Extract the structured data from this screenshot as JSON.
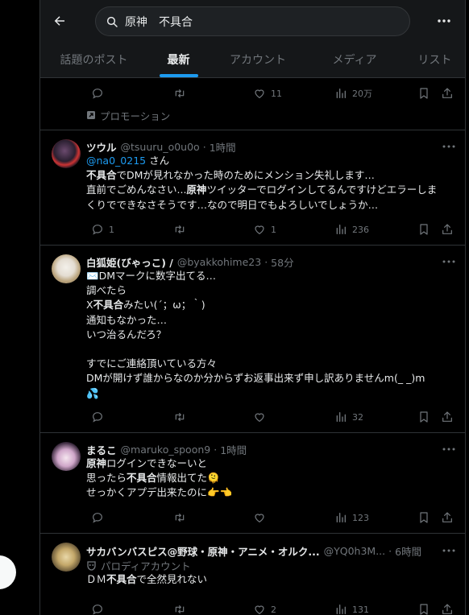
{
  "header": {
    "search_query": "原神　不具合",
    "tabs": [
      {
        "label": "話題のポスト",
        "active": false
      },
      {
        "label": "最新",
        "active": true
      },
      {
        "label": "アカウント",
        "active": false
      },
      {
        "label": "メディア",
        "active": false
      },
      {
        "label": "リスト",
        "active": false
      }
    ]
  },
  "colors": {
    "accent": "#1d9bf0",
    "background": "#000000",
    "muted": "#71767b"
  },
  "promo": {
    "reply_count": "",
    "retweet_count": "",
    "like_count": "11",
    "views": "20万",
    "label": "プロモーション"
  },
  "posts": [
    {
      "name": "ツウル",
      "handle": "@tsuuru_o0u0o",
      "time": "1時間",
      "mention": "@na0_0215",
      "mention_suffix": " さん",
      "lines": [
        [
          [
            "b",
            "不具合"
          ],
          [
            "t",
            "でDMが見れなかった時のためにメンション失礼します…"
          ]
        ],
        [
          [
            "t",
            "直前でごめんなさい..."
          ],
          [
            "b",
            "原神"
          ],
          [
            "t",
            "ツイッターでログインしてるんですけどエラーしま"
          ]
        ],
        [
          [
            "t",
            "くりでできなさそうです…なので明日でもよろしいでしょうか…"
          ]
        ]
      ],
      "reply_count": "1",
      "retweet_count": "",
      "like_count": "1",
      "views": "236"
    },
    {
      "name": "白狐姫(びゃっこ) /",
      "handle": "@byakkohime23",
      "time": "58分",
      "lines": [
        [
          [
            "t",
            "✉️DMマークに数字出てる…"
          ]
        ],
        [
          [
            "t",
            "調べたら"
          ]
        ],
        [
          [
            "t",
            "X"
          ],
          [
            "b",
            "不具合"
          ],
          [
            "t",
            "みたい(´；ω；｀)"
          ]
        ],
        [
          [
            "t",
            "通知もなかった…"
          ]
        ],
        [
          [
            "t",
            "いつ治るんだろ？"
          ]
        ],
        [
          [
            "t",
            " "
          ]
        ],
        [
          [
            "t",
            "すでにご連絡頂いている方々"
          ]
        ],
        [
          [
            "t",
            "DMが開けず誰からなのか分からずお返事出来ず申し訳ありませんm(_ _)m"
          ]
        ],
        [
          [
            "t",
            "💦"
          ]
        ]
      ],
      "reply_count": "",
      "retweet_count": "",
      "like_count": "",
      "views": "32"
    },
    {
      "name": "まるこ",
      "handle": "@maruko_spoon9",
      "time": "1時間",
      "lines": [
        [
          [
            "b",
            "原神"
          ],
          [
            "t",
            "ログインできなーいと"
          ]
        ],
        [
          [
            "t",
            "思ったら"
          ],
          [
            "b",
            "不具合"
          ],
          [
            "t",
            "情報出てた🫠"
          ]
        ],
        [
          [
            "t",
            "せっかくアプデ出来たのに👉👈"
          ]
        ]
      ],
      "reply_count": "",
      "retweet_count": "",
      "like_count": "",
      "views": "123"
    },
    {
      "name": "サカバンバスピス@野球・原神・アニメ・オルク...",
      "handle": "@YQ0h3M...",
      "time": "6時間",
      "parody_label": "パロディアカウント",
      "lines": [
        [
          [
            "t",
            "ＤＭ"
          ],
          [
            "b",
            "不具合"
          ],
          [
            "t",
            "で全然見れない"
          ]
        ]
      ],
      "reply_count": "",
      "retweet_count": "",
      "like_count": "2",
      "views": "131"
    }
  ]
}
